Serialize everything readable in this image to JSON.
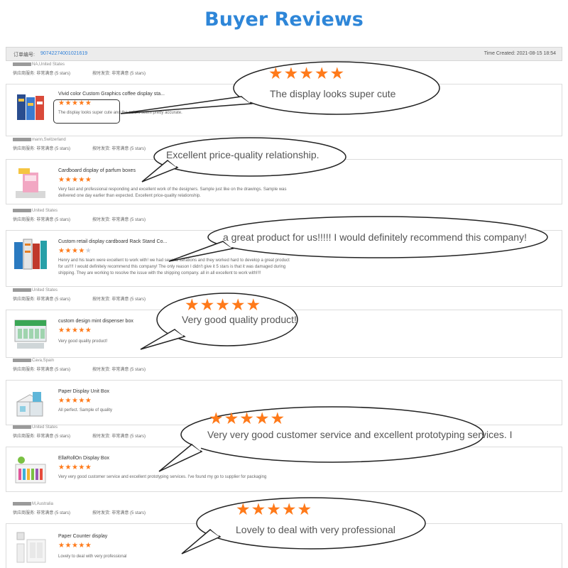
{
  "page_title": "Buyer Reviews",
  "order": {
    "label": "订单编号:",
    "number": "90742274001021619",
    "time": "Time Created: 2021-08-15 18:54"
  },
  "rating_labels": {
    "service": "供应商服务:",
    "delivery": "按时发货:",
    "verdict": "非常满意",
    "count": "(5 stars)"
  },
  "reviews": [
    {
      "user": "NA,United States",
      "product": "Vivid color Custom Graphics coffee display sta...",
      "rating": 5,
      "text": "The display looks super cute and the colors seem pretty accurate.",
      "bubble": "The display looks super cute",
      "bubble_rating": 5
    },
    {
      "user": "mann,Switzerland",
      "product": "Cardboard display of parfum boxes",
      "rating": 5,
      "text": "Very fast and professional responding and excellent work of the designers. Sample just like on the drawings. Sample was delivered one day earlier than expected. Excellent price-quality relationship.",
      "bubble": "Excellent price-quality relationship.",
      "bubble_rating": 0
    },
    {
      "user": "United States",
      "product": "Custom retail display cardboard Rack Stand Co...",
      "rating": 4,
      "text": "Henry and his team were excellent to work with! we had several iterations and they worked hard to develop a great product for us!!!! I would definitely recommend this company! The only reason I didn't give it 5 stars is that it was damaged during shipping. They are working to resolve the issue with the shipping company. all in all excellent to work with!!!!",
      "bubble": "a great product for us!!!!! I would definitely recommend this company!",
      "bubble_rating": 0
    },
    {
      "user": "United States",
      "product": "custom design mint dispenser box",
      "rating": 5,
      "text": "Very good quality product!",
      "bubble": "Very good quality product!",
      "bubble_rating": 5
    },
    {
      "user": "Cava,Spain",
      "product": "Paper Display Unit Box",
      "rating": 5,
      "text": "All perfect. Sample of quality",
      "bubble": "",
      "bubble_rating": 0
    },
    {
      "user": "United States",
      "product": "EllaRollOn Display Box",
      "rating": 5,
      "text": "Very very good customer service and excellent prototyping services. I've found my go to supplier for packaging",
      "bubble": "Very very good customer service and excellent prototyping services. I",
      "bubble_rating": 5
    },
    {
      "user": "M,Australia",
      "product": "Paper Counter display",
      "rating": 5,
      "text": "Lovely to deal with very professional",
      "bubble": "Lovely to deal with very professional",
      "bubble_rating": 5
    }
  ],
  "colors": {
    "title": "#2e86d8",
    "star": "#ff7a1a",
    "link": "#2e7fd8"
  }
}
